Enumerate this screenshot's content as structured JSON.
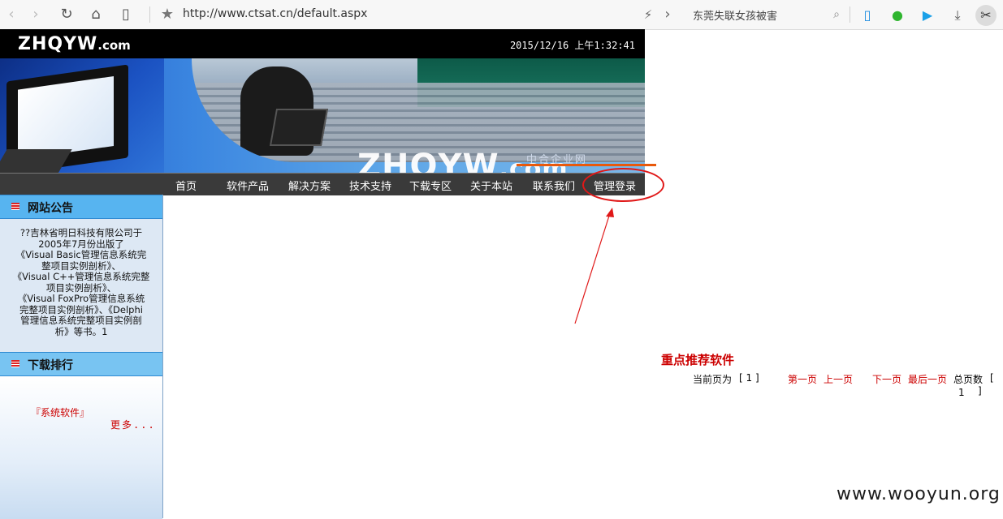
{
  "browser": {
    "url": "http://www.ctsat.cn/default.aspx",
    "search_text": "东莞失联女孩被害"
  },
  "header": {
    "logo_main": "ZHQYW",
    "logo_suffix": ".com",
    "datetime": "2015/12/16 上午1:32:41",
    "banner_logo_main": "ZHQYW",
    "banner_logo_suffix": ".com",
    "banner_cn": "中合企业网"
  },
  "nav": {
    "items": [
      "首页",
      "软件产品",
      "解决方案",
      "技术支持",
      "下载专区",
      "关于本站",
      "联系我们",
      "管理登录"
    ]
  },
  "sidebar": {
    "notice_title": "网站公告",
    "notice_lines": [
      "??吉林省明日科技有限公司于",
      "2005年7月份出版了",
      "《Visual  Basic管理信息系统完",
      "整项目实例剖析》、",
      "《Visual  C++管理信息系统完整",
      "项目实例剖析》、",
      "《Visual  FoxPro管理信息系统",
      "完整项目实例剖析》、《Delphi",
      "管理信息系统完整项目实例剖",
      "析》等书。1"
    ],
    "rank_title": "下载排行",
    "rank_item": "『系统软件』",
    "rank_more": "更多..."
  },
  "content": {
    "rec_title": "重点推荐软件",
    "current_page_label": "当前页为",
    "current_page_value": "[ 1 ]",
    "first": "第一页",
    "prev": "上一页",
    "next": "下一页",
    "last": "最后一页",
    "total_label": "总页数",
    "total_open": "[",
    "total_value": "1",
    "total_close": "]"
  },
  "watermark": "www.wooyun.org",
  "colors": {
    "annotation_red": "#e01818",
    "nav_bg": "#3a3a3a",
    "link_red": "#cc0000",
    "sidebar_head": "#57b4f0"
  }
}
